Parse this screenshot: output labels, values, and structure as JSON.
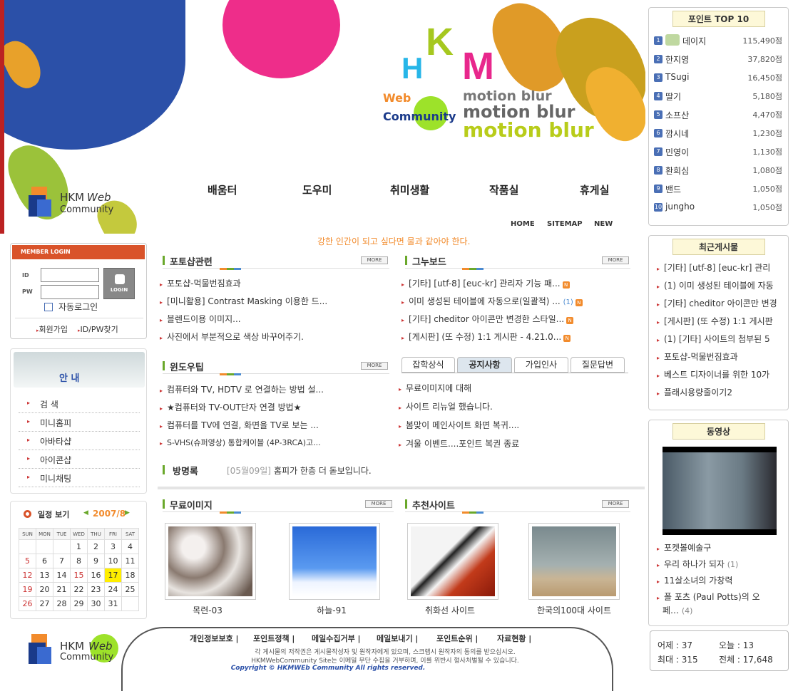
{
  "banner": {
    "logo_letters": [
      "H",
      "K",
      "M"
    ],
    "web_word": "Web",
    "community_word": "Community",
    "motion_lines": [
      "motion blur",
      "motion blur",
      "motion blur"
    ],
    "brand_hkm": "HKM",
    "brand_web": "Web",
    "brand_community": "Community"
  },
  "nav": [
    "배움터",
    "도우미",
    "취미생활",
    "작품실",
    "휴게실"
  ],
  "toplinks": [
    "HOME",
    "SITEMAP",
    "NEW"
  ],
  "slogan": "강한 인간이 되고 싶다면 물과 같아야 한다.",
  "login": {
    "title": "MEMBER LOGIN",
    "id_label": "ID",
    "pw_label": "PW",
    "button": "LOGIN",
    "auto_login": "자동로그인",
    "join": "회원가입",
    "find": "ID/PW찾기"
  },
  "guide": {
    "title": "안    내",
    "items": [
      "검      색",
      "미니홈피",
      "아바타샵",
      "아이콘샵",
      "미니채팅"
    ]
  },
  "calendar": {
    "title": "일정 보기",
    "month": "2007/8",
    "days": [
      "SUN",
      "MON",
      "TUE",
      "WED",
      "THU",
      "FRI",
      "SAT"
    ],
    "weeks": [
      [
        "",
        "",
        "",
        "1",
        "2",
        "3",
        "4"
      ],
      [
        "5",
        "6",
        "7",
        "8",
        "9",
        "10",
        "11"
      ],
      [
        "12",
        "13",
        "14",
        "15",
        "16",
        "17",
        "18"
      ],
      [
        "19",
        "20",
        "21",
        "22",
        "23",
        "24",
        "25"
      ],
      [
        "26",
        "27",
        "28",
        "29",
        "30",
        "31",
        ""
      ]
    ],
    "today": "17"
  },
  "sections": {
    "photoshop": {
      "title": "포토샵관련",
      "more": "MORE",
      "items": [
        "포토샵-먹물번짐효과",
        "[미니활용] Contrast Masking 이용한 드...",
        "블렌드이용 이미지...",
        "사진에서 부분적으로 색상 바꾸어주기."
      ]
    },
    "gnuboard": {
      "title": "그누보드",
      "more": "MORE",
      "items": [
        "[기타] [utf-8] [euc-kr] 관리자 기능 패...",
        "이미 생성된 테이블에 자동으로(일괄적) ...",
        "[기타] cheditor 아이콘만 변경한 스타일...",
        "[게시판] (또 수정) 1:1 게시판 - 4.21.0..."
      ],
      "extra_count": "(1)",
      "new_badge": "N"
    },
    "windows": {
      "title": "윈도우팁",
      "more": "MORE",
      "items": [
        "컴퓨터와 TV, HDTV 로 연결하는 방법 설...",
        "★컴퓨터와 TV-OUT단자 연결 방법★",
        "컴퓨터를 TV에 연결, 화면을 TV로 보는 ...",
        "S-VHS(슈퍼영상) 통합케이블 (4P-3RCA)고..."
      ]
    },
    "tabs": [
      "잡학상식",
      "공지사항",
      "가입인사",
      "질문답변"
    ],
    "notices": [
      "무료이미지에 대해",
      "사이트 리뉴얼 했습니다.",
      "봄맞이 메인사이트 화면 복귀....",
      "겨울 이벤트....포인트 복권 종료"
    ],
    "guestbook": {
      "title": "방명록",
      "date": "[05월09일]",
      "text": "홈피가 한층 더 돋보입니다."
    },
    "free_images": {
      "title": "무료이미지",
      "more": "MORE"
    },
    "recommend": {
      "title": "추천사이트",
      "more": "MORE"
    },
    "thumbs": [
      "목련-03",
      "하늘-91",
      "취화선 사이트",
      "한국의100대 사이트"
    ]
  },
  "points": {
    "title": "포인트 TOP 10",
    "rows": [
      {
        "n": "1",
        "name": "데이지",
        "pts": "115,490점"
      },
      {
        "n": "2",
        "name": "한지영",
        "pts": "37,820점"
      },
      {
        "n": "3",
        "name": "TSugi",
        "pts": "16,450점"
      },
      {
        "n": "4",
        "name": "딸기",
        "pts": "5,180점"
      },
      {
        "n": "5",
        "name": "소프산",
        "pts": "4,470점"
      },
      {
        "n": "6",
        "name": "깜시네",
        "pts": "1,230점"
      },
      {
        "n": "7",
        "name": "민영이",
        "pts": "1,130점"
      },
      {
        "n": "8",
        "name": "환희심",
        "pts": "1,080점"
      },
      {
        "n": "9",
        "name": "밴드",
        "pts": "1,050점"
      },
      {
        "n": "10",
        "name": "jungho",
        "pts": "1,050점"
      }
    ]
  },
  "recent": {
    "title": "최근게시물",
    "items": [
      "[기타] [utf-8] [euc-kr] 관리",
      "(1) 이미 생성된 테이블에 자동",
      "[기타] cheditor 아이콘만 변경",
      "[게시판] (또 수정) 1:1 게시판",
      "(1) [기타] 사이트의 첨부된 5",
      "포토샵-먹물번짐효과",
      "베스트 디자이너를 위한 10가",
      "플래시용량줄이기2"
    ]
  },
  "video": {
    "title": "동영상",
    "items": [
      "포켓볼예술구",
      "우리 하나가 되자",
      "11살소녀의 가창력",
      "폴 포츠 (Paul Potts)의 오",
      "페…"
    ],
    "count1": "(1)",
    "count2": "(4)"
  },
  "stats": {
    "yesterday": "어제 : 37",
    "today": "오늘 : 13",
    "max": "최대 : 315",
    "total": "전체 : 17,648"
  },
  "footer": {
    "links": [
      "개인정보보호 |",
      "포인트정책 |",
      "메일수집거부 |",
      "메일보내기 |",
      "포인트순위 |",
      "자료현황 |"
    ],
    "line1": "각 게시물의 저작권은 게시물작성자 및 원작자에게 있으며, 스크랩시 원작자의 동의를 받으십시오.",
    "line2": "HKMWebCommunity Site는 이메일 무단 수집을 거부하며, 이를 위반시 형사처벌될 수 있습니다.",
    "copyright": "Copyright  ©  HKMWEb Community All rights reserved."
  },
  "colors": {
    "accent_orange": "#f28b2c",
    "green": "#6aa82b",
    "blue_blob": "#2b50a8",
    "pink_blob": "#ee2d8a",
    "login_red": "#d9532a"
  }
}
